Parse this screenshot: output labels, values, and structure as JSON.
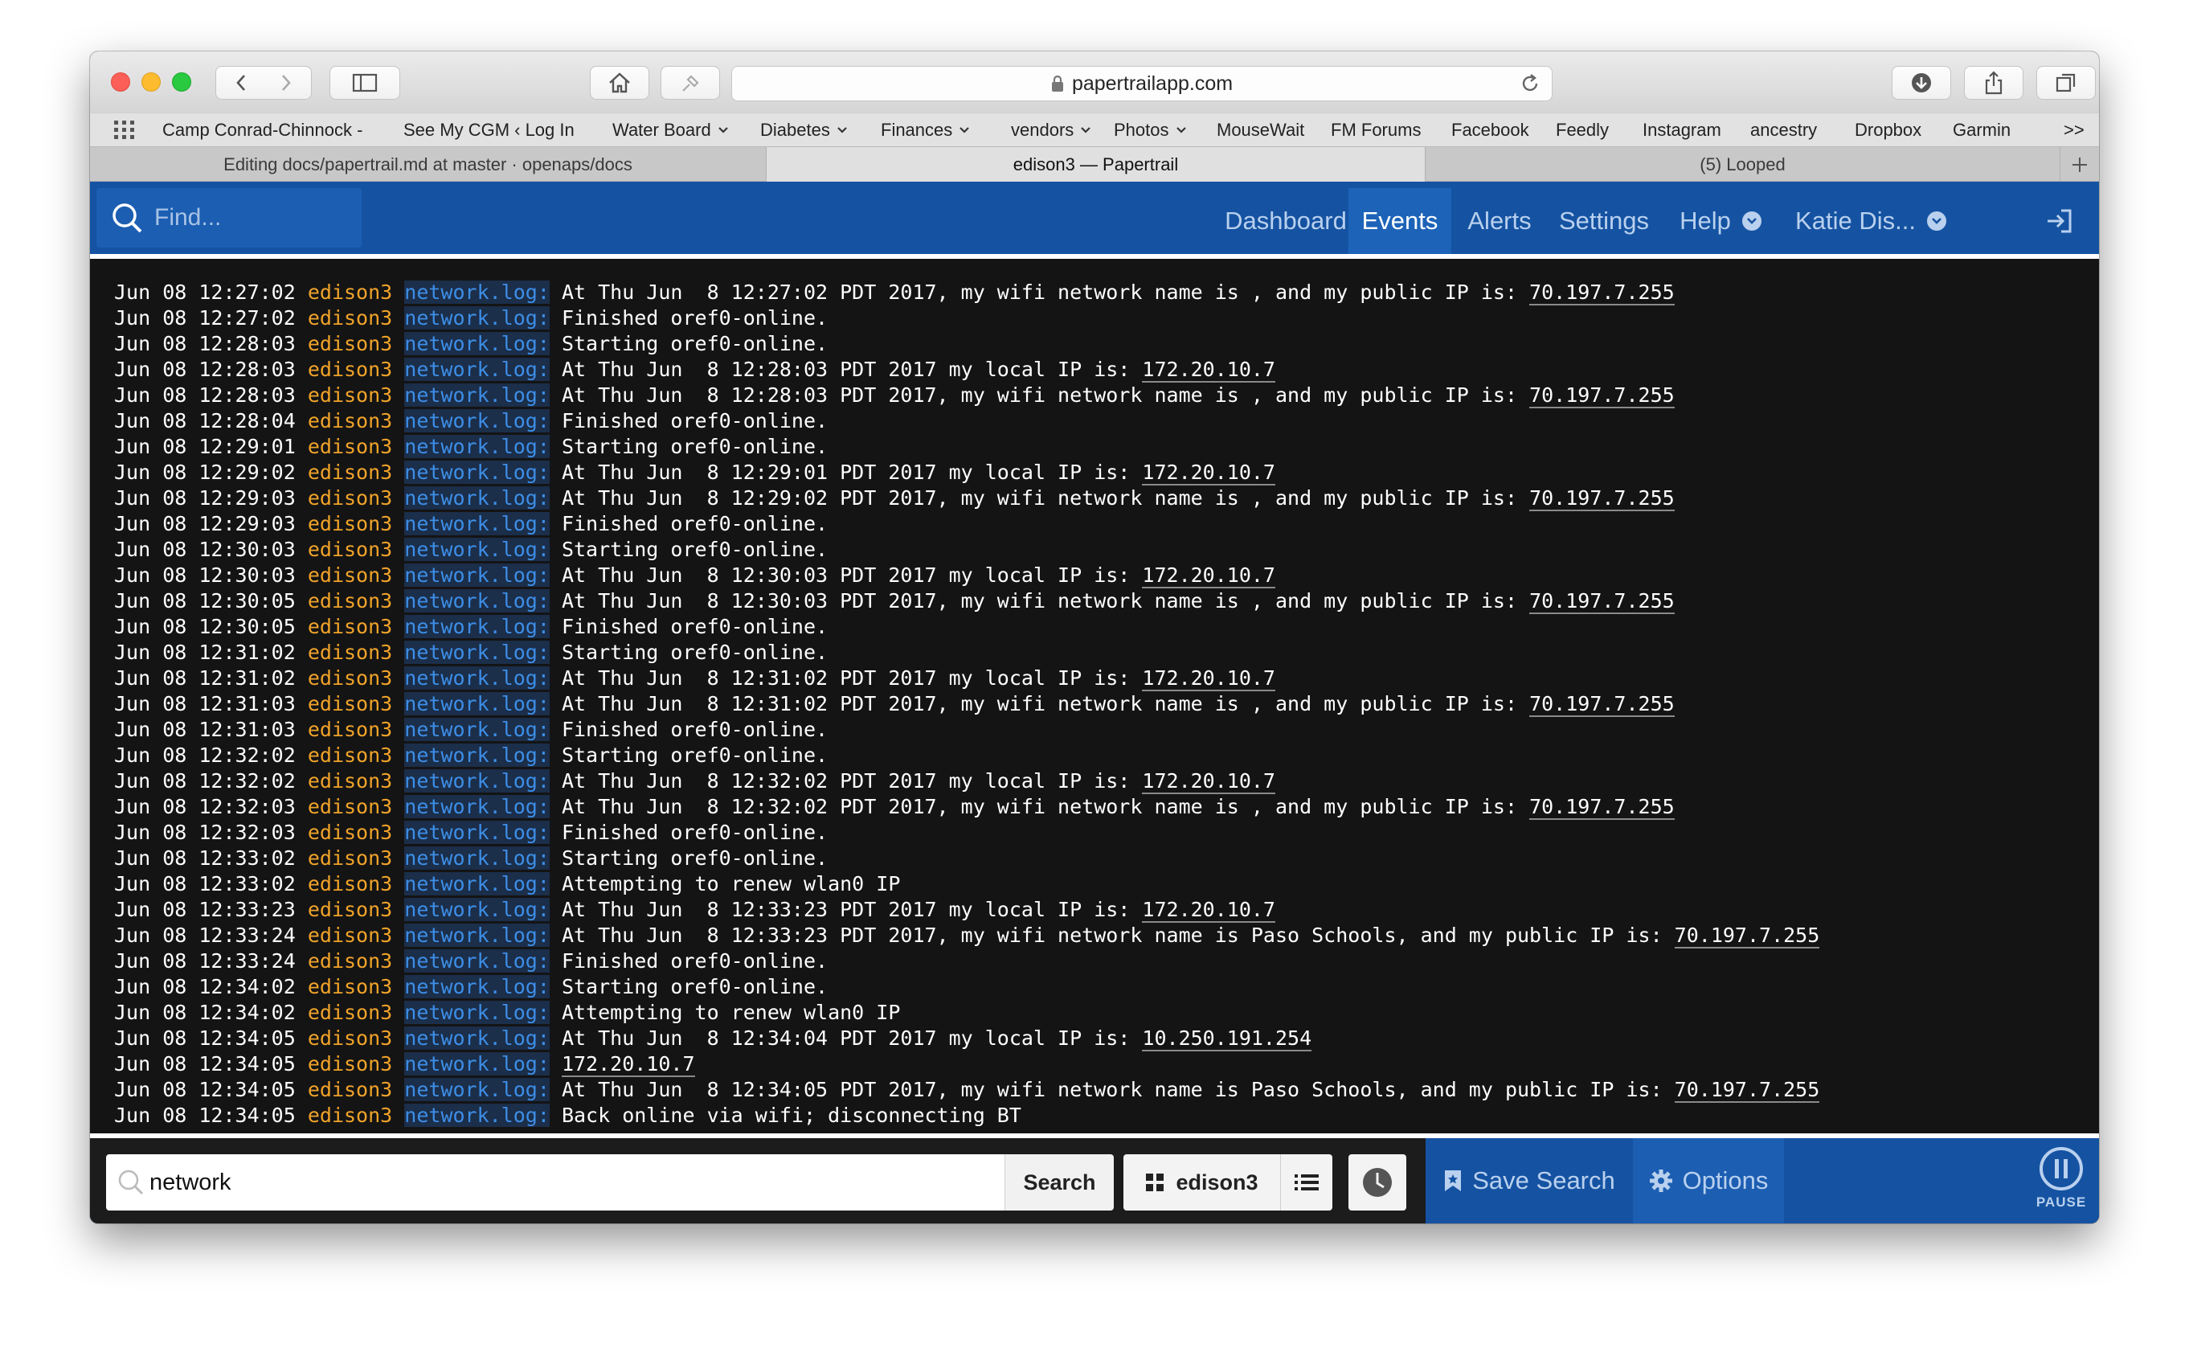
{
  "browser": {
    "url": "papertrailapp.com",
    "bookmarks": [
      {
        "label": "Camp Conrad-Chinnock -",
        "dropdown": false
      },
      {
        "label": "See My CGM ‹ Log In",
        "dropdown": false
      },
      {
        "label": "Water Board",
        "dropdown": true
      },
      {
        "label": "Diabetes",
        "dropdown": true
      },
      {
        "label": "Finances",
        "dropdown": true
      },
      {
        "label": "vendors",
        "dropdown": true
      },
      {
        "label": "Photos",
        "dropdown": true
      },
      {
        "label": "MouseWait",
        "dropdown": false
      },
      {
        "label": "FM Forums",
        "dropdown": false
      },
      {
        "label": "Facebook",
        "dropdown": false
      },
      {
        "label": "Feedly",
        "dropdown": false
      },
      {
        "label": "Instagram",
        "dropdown": false
      },
      {
        "label": "ancestry",
        "dropdown": false
      },
      {
        "label": "Dropbox",
        "dropdown": false
      },
      {
        "label": "Garmin",
        "dropdown": false
      }
    ],
    "overflow": ">>",
    "tabs": [
      {
        "label": "Editing docs/papertrail.md at master · openaps/docs",
        "active": false
      },
      {
        "label": "edison3 — Papertrail",
        "active": true
      },
      {
        "label": "(5) Looped",
        "active": false
      }
    ]
  },
  "nav": {
    "find_placeholder": "Find...",
    "items": [
      {
        "label": "Dashboard",
        "active": false
      },
      {
        "label": "Events",
        "active": true
      },
      {
        "label": "Alerts",
        "active": false
      },
      {
        "label": "Settings",
        "active": false
      },
      {
        "label": "Help",
        "active": false
      },
      {
        "label": "Katie Dis...",
        "active": false
      }
    ]
  },
  "logs": [
    {
      "time": "Jun 08 12:27:02",
      "host": "edison3",
      "prog": "network.log:",
      "text": "At Thu Jun  8 12:27:02 PDT 2017, my wifi network name is , and my public IP is: ",
      "link": "70.197.7.255",
      "after": ""
    },
    {
      "time": "Jun 08 12:27:02",
      "host": "edison3",
      "prog": "network.log:",
      "text": "Finished oref0-online.",
      "link": "",
      "after": ""
    },
    {
      "time": "Jun 08 12:28:03",
      "host": "edison3",
      "prog": "network.log:",
      "text": "Starting oref0-online.",
      "link": "",
      "after": ""
    },
    {
      "time": "Jun 08 12:28:03",
      "host": "edison3",
      "prog": "network.log:",
      "text": "At Thu Jun  8 12:28:03 PDT 2017 my local IP is: ",
      "link": "172.20.10.7",
      "after": ""
    },
    {
      "time": "Jun 08 12:28:03",
      "host": "edison3",
      "prog": "network.log:",
      "text": "At Thu Jun  8 12:28:03 PDT 2017, my wifi network name is , and my public IP is: ",
      "link": "70.197.7.255",
      "after": ""
    },
    {
      "time": "Jun 08 12:28:04",
      "host": "edison3",
      "prog": "network.log:",
      "text": "Finished oref0-online.",
      "link": "",
      "after": ""
    },
    {
      "time": "Jun 08 12:29:01",
      "host": "edison3",
      "prog": "network.log:",
      "text": "Starting oref0-online.",
      "link": "",
      "after": ""
    },
    {
      "time": "Jun 08 12:29:02",
      "host": "edison3",
      "prog": "network.log:",
      "text": "At Thu Jun  8 12:29:01 PDT 2017 my local IP is: ",
      "link": "172.20.10.7",
      "after": ""
    },
    {
      "time": "Jun 08 12:29:03",
      "host": "edison3",
      "prog": "network.log:",
      "text": "At Thu Jun  8 12:29:02 PDT 2017, my wifi network name is , and my public IP is: ",
      "link": "70.197.7.255",
      "after": ""
    },
    {
      "time": "Jun 08 12:29:03",
      "host": "edison3",
      "prog": "network.log:",
      "text": "Finished oref0-online.",
      "link": "",
      "after": ""
    },
    {
      "time": "Jun 08 12:30:03",
      "host": "edison3",
      "prog": "network.log:",
      "text": "Starting oref0-online.",
      "link": "",
      "after": ""
    },
    {
      "time": "Jun 08 12:30:03",
      "host": "edison3",
      "prog": "network.log:",
      "text": "At Thu Jun  8 12:30:03 PDT 2017 my local IP is: ",
      "link": "172.20.10.7",
      "after": ""
    },
    {
      "time": "Jun 08 12:30:05",
      "host": "edison3",
      "prog": "network.log:",
      "text": "At Thu Jun  8 12:30:03 PDT 2017, my wifi network name is , and my public IP is: ",
      "link": "70.197.7.255",
      "after": ""
    },
    {
      "time": "Jun 08 12:30:05",
      "host": "edison3",
      "prog": "network.log:",
      "text": "Finished oref0-online.",
      "link": "",
      "after": ""
    },
    {
      "time": "Jun 08 12:31:02",
      "host": "edison3",
      "prog": "network.log:",
      "text": "Starting oref0-online.",
      "link": "",
      "after": ""
    },
    {
      "time": "Jun 08 12:31:02",
      "host": "edison3",
      "prog": "network.log:",
      "text": "At Thu Jun  8 12:31:02 PDT 2017 my local IP is: ",
      "link": "172.20.10.7",
      "after": ""
    },
    {
      "time": "Jun 08 12:31:03",
      "host": "edison3",
      "prog": "network.log:",
      "text": "At Thu Jun  8 12:31:02 PDT 2017, my wifi network name is , and my public IP is: ",
      "link": "70.197.7.255",
      "after": ""
    },
    {
      "time": "Jun 08 12:31:03",
      "host": "edison3",
      "prog": "network.log:",
      "text": "Finished oref0-online.",
      "link": "",
      "after": ""
    },
    {
      "time": "Jun 08 12:32:02",
      "host": "edison3",
      "prog": "network.log:",
      "text": "Starting oref0-online.",
      "link": "",
      "after": ""
    },
    {
      "time": "Jun 08 12:32:02",
      "host": "edison3",
      "prog": "network.log:",
      "text": "At Thu Jun  8 12:32:02 PDT 2017 my local IP is: ",
      "link": "172.20.10.7",
      "after": ""
    },
    {
      "time": "Jun 08 12:32:03",
      "host": "edison3",
      "prog": "network.log:",
      "text": "At Thu Jun  8 12:32:02 PDT 2017, my wifi network name is , and my public IP is: ",
      "link": "70.197.7.255",
      "after": ""
    },
    {
      "time": "Jun 08 12:32:03",
      "host": "edison3",
      "prog": "network.log:",
      "text": "Finished oref0-online.",
      "link": "",
      "after": ""
    },
    {
      "time": "Jun 08 12:33:02",
      "host": "edison3",
      "prog": "network.log:",
      "text": "Starting oref0-online.",
      "link": "",
      "after": ""
    },
    {
      "time": "Jun 08 12:33:02",
      "host": "edison3",
      "prog": "network.log:",
      "text": "Attempting to renew wlan0 IP",
      "link": "",
      "after": ""
    },
    {
      "time": "Jun 08 12:33:23",
      "host": "edison3",
      "prog": "network.log:",
      "text": "At Thu Jun  8 12:33:23 PDT 2017 my local IP is: ",
      "link": "172.20.10.7",
      "after": ""
    },
    {
      "time": "Jun 08 12:33:24",
      "host": "edison3",
      "prog": "network.log:",
      "text": "At Thu Jun  8 12:33:23 PDT 2017, my wifi network name is Paso Schools, and my public IP is: ",
      "link": "70.197.7.255",
      "after": ""
    },
    {
      "time": "Jun 08 12:33:24",
      "host": "edison3",
      "prog": "network.log:",
      "text": "Finished oref0-online.",
      "link": "",
      "after": ""
    },
    {
      "time": "Jun 08 12:34:02",
      "host": "edison3",
      "prog": "network.log:",
      "text": "Starting oref0-online.",
      "link": "",
      "after": ""
    },
    {
      "time": "Jun 08 12:34:02",
      "host": "edison3",
      "prog": "network.log:",
      "text": "Attempting to renew wlan0 IP",
      "link": "",
      "after": ""
    },
    {
      "time": "Jun 08 12:34:05",
      "host": "edison3",
      "prog": "network.log:",
      "text": "At Thu Jun  8 12:34:04 PDT 2017 my local IP is: ",
      "link": "10.250.191.254",
      "after": ""
    },
    {
      "time": "Jun 08 12:34:05",
      "host": "edison3",
      "prog": "network.log:",
      "text": "",
      "link": "172.20.10.7",
      "after": ""
    },
    {
      "time": "Jun 08 12:34:05",
      "host": "edison3",
      "prog": "network.log:",
      "text": "At Thu Jun  8 12:34:05 PDT 2017, my wifi network name is Paso Schools, and my public IP is: ",
      "link": "70.197.7.255",
      "after": ""
    },
    {
      "time": "Jun 08 12:34:05",
      "host": "edison3",
      "prog": "network.log:",
      "text": "Back online via wifi; disconnecting BT",
      "link": "",
      "after": ""
    }
  ],
  "bottom": {
    "search_value": "network",
    "search_button": "Search",
    "group": "edison3",
    "save_search": "Save Search",
    "options": "Options",
    "pause": "PAUSE"
  },
  "colors": {
    "papertrail_blue": "#1553a2",
    "host_orange": "#f0a32a",
    "program_blue": "#3d8ee6",
    "log_background": "#141414"
  }
}
